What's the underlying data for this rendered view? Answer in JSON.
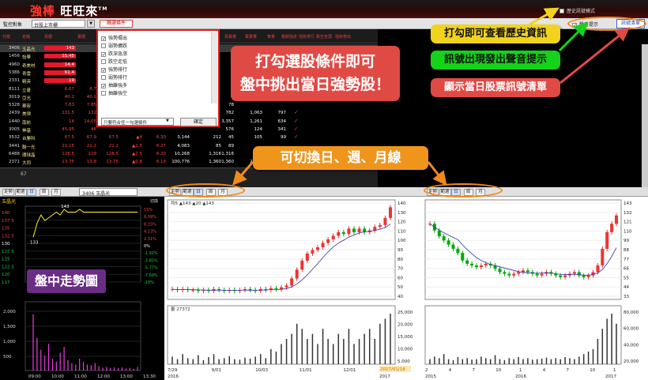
{
  "app": {
    "logo_main": "強棒",
    "logo_rest": "旺旺來",
    "logo_tm": "TM",
    "history_mode": "歷史訊號模式"
  },
  "toolbar": {
    "monitor_label": "監控對象",
    "monitor_value": "台股上市櫃",
    "screen_button": "篩選條件",
    "sound_label": "聲音提示",
    "signal_list_button": "訊號清單"
  },
  "grid": {
    "headers": [
      "代號",
      "名稱",
      "買價",
      "賣價",
      "",
      "",
      "",
      "",
      "",
      "",
      "",
      "",
      "",
      "",
      "",
      "",
      "",
      "買賣量",
      "賣賣量",
      "筆量",
      "趨勢強走",
      "強勢排行",
      "跌空走弱",
      "強勢帶出"
    ],
    "rows": [
      {
        "sym": "3406",
        "name": "玉晶光",
        "price": "143",
        "bid": "",
        "c3": "",
        "c4": "",
        "c5": "",
        "chk": false,
        "sel": true,
        "hl": true
      },
      {
        "sym": "1456",
        "name": "怡華",
        "price": "15.45",
        "bid": "",
        "c3": "",
        "c4": "",
        "c5": "",
        "chk": false,
        "hl": true
      },
      {
        "sym": "4960",
        "name": "奇美材",
        "price": "14.4",
        "bid": "",
        "c3": "",
        "c4": "",
        "c5": "",
        "chk": false,
        "hl": true
      },
      {
        "sym": "5386",
        "name": "青雲",
        "price": "61.4",
        "bid": "",
        "c3": "",
        "c4": "",
        "c5": "",
        "chk": false,
        "hl": true
      },
      {
        "sym": "2331",
        "name": "精英",
        "price": "19",
        "bid": "",
        "c3": "",
        "c4": "",
        "c5": "",
        "chk": false,
        "hl": true
      },
      {
        "sym": "8111",
        "name": "立碁",
        "price": "6.67",
        "bid": "6.7",
        "c3": "",
        "c4": "",
        "c5": "",
        "chk": false
      },
      {
        "sym": "3019",
        "name": "亞光",
        "price": "40.1",
        "bid": "40.1",
        "c3": "",
        "c4": "",
        "c5": "",
        "chk": false
      },
      {
        "sym": "5328",
        "name": "華容",
        "price": "7.83",
        "bid": "7.85",
        "c3": "78",
        "c4": "",
        "c5": "",
        "chk": false
      },
      {
        "sym": "2439",
        "name": "美律",
        "price": "131.5",
        "bid": "132",
        "c3": "782",
        "c4": "1,063",
        "c5": "797",
        "chk": true
      },
      {
        "sym": "1440",
        "name": "南紡",
        "price": "14",
        "bid": "14.05",
        "c3": "3,357",
        "c4": "1,261",
        "c5": "634",
        "chk": true
      },
      {
        "sym": "3005",
        "name": "神基",
        "price": "45.95",
        "bid": "46",
        "c3": "576",
        "c4": "124",
        "c5": "341",
        "chk": true
      },
      {
        "sym": "3532",
        "name": "台勝科",
        "price": "67.5",
        "bid": "67.9",
        "c3": "45",
        "c4": "105",
        "c5": "99",
        "chk": true
      },
      {
        "sym": "3441",
        "name": "聯一光",
        "price": "21.15",
        "bid": "21.2",
        "c3": "89",
        "c4": "",
        "c5": "",
        "chk": false
      },
      {
        "sym": "6488",
        "name": "環球晶",
        "price": "128.5",
        "bid": "129",
        "c3": "1,316",
        "c4": "147",
        "c5": "",
        "chk": false
      },
      {
        "sym": "2371",
        "name": "大同",
        "price": "13.75",
        "bid": "13.8",
        "c3": "1,360",
        "c4": "2,250",
        "c5": "",
        "chk": false
      }
    ],
    "extra": [
      {
        "v1": "21.2",
        "v2": "▲1.5",
        "v3": "6.27",
        "v4": "4,083",
        "v5": "85"
      },
      {
        "v1": "128.5",
        "v2": "▲7.5",
        "v3": "6.20",
        "v4": "10,268",
        "v5": "1,316"
      },
      {
        "v1": "13.75",
        "v2": "▲0.8",
        "v3": "6.18",
        "v4": "100,776",
        "v5": "1,360"
      },
      {
        "v1": "67.5",
        "v2": "▲4",
        "v3": "6.30",
        "v4": "3,144",
        "v5": "212"
      }
    ],
    "footer_count": "67"
  },
  "popup": {
    "items": [
      {
        "label": "強勢擺出",
        "checked": true
      },
      {
        "label": "弱勢擴跌",
        "checked": false
      },
      {
        "label": "跌深急漲",
        "checked": true
      },
      {
        "label": "跌空走低",
        "checked": false
      },
      {
        "label": "強勢排行",
        "checked": true
      },
      {
        "label": "弱勢排行",
        "checked": false
      },
      {
        "label": "抽離強多",
        "checked": true
      },
      {
        "label": "抽離強空",
        "checked": false
      }
    ],
    "mode": "只要符合任一勾選條件",
    "ok": "確定"
  },
  "callouts": {
    "a1": "打勾選股條件即可",
    "a2": "盤中挑出當日強勢股！",
    "b": "可切換日、週、月線",
    "c": "打勾即可查看歷史資訊",
    "d": "訊號出現發出聲音提示",
    "e": "顯示當日股票訊號清單",
    "f": "盤中走勢圖"
  },
  "tabs": [
    "走勢",
    "範選",
    "日",
    "周",
    "月"
  ],
  "intraday": {
    "stock": "3406 玉晶光",
    "title": "玉晶光",
    "switch": "切換",
    "high": "143",
    "low": "133",
    "price_ticks": [
      "140",
      "137.5",
      "135",
      "132.5",
      "130",
      "127.5",
      "125",
      "122.5",
      "120",
      "117"
    ],
    "pct_ticks": [
      "15%",
      "8.09%",
      "6.15%",
      "4.23%",
      "2.31%",
      "0%",
      "-1.92%",
      "-3.85%",
      "-5.77%",
      "-7.69%",
      "-10%"
    ],
    "vol_ticks": [
      "2,000",
      "1,500",
      "1,000",
      "500"
    ],
    "time_ticks": [
      "09:00",
      "10:00",
      "11:00",
      "12:00",
      "13:00",
      "13:30"
    ],
    "chart_data": {
      "type": "line",
      "x": [
        "09:00",
        "09:10",
        "09:20",
        "09:30",
        "09:40",
        "09:50",
        "10:00",
        "10:10",
        "10:20",
        "10:30",
        "10:40",
        "10:50",
        "11:00",
        "11:10",
        "11:20",
        "11:30",
        "11:40",
        "11:50",
        "12:00",
        "12:10",
        "12:20",
        "12:30",
        "12:40",
        "12:50",
        "13:00",
        "13:10",
        "13:20",
        "13:30"
      ],
      "series": [
        {
          "values": [
            133,
            138,
            141,
            139,
            140,
            141,
            142,
            141,
            143,
            142,
            142,
            142,
            143,
            142,
            142,
            142,
            142,
            142,
            142,
            142,
            142,
            142,
            142,
            142,
            142,
            142,
            142,
            142
          ]
        }
      ],
      "ylim": [
        117,
        143
      ]
    }
  },
  "daily": {
    "ma_label": "均5 ▲143 ▲20 ▲143",
    "vol_label": "量 27372",
    "price_ticks": [
      "140",
      "130",
      "120",
      "110",
      "100",
      "90",
      "80",
      "70",
      "60",
      "50",
      "40"
    ],
    "vol_ticks": [
      "25,000",
      "20,000",
      "15,000",
      "10,000",
      "5,000"
    ],
    "date_ticks": [
      "7/29",
      "9/01",
      "10/03",
      "11/01",
      "12/01",
      "1/03"
    ],
    "years": [
      "2016",
      "2017"
    ],
    "date_stamp": "2017/01/18",
    "chart_data": {
      "type": "line",
      "series": [
        {
          "name": "收盤",
          "values": [
            48,
            47,
            48,
            47,
            47,
            46,
            47,
            46,
            48,
            47,
            46,
            47,
            46,
            47,
            48,
            47,
            46,
            48,
            47,
            49,
            48,
            50,
            52,
            60,
            70,
            80,
            88,
            92,
            95,
            100,
            104,
            108,
            112,
            110,
            116,
            112,
            116,
            112,
            114,
            118,
            120,
            128,
            140
          ]
        }
      ],
      "ylim": [
        40,
        143
      ]
    }
  },
  "weekly": {
    "price_ticks": [
      "143",
      "132",
      "121",
      "110",
      "99",
      "88",
      "77",
      "66",
      "55",
      "44",
      "33"
    ],
    "vol_ticks": [
      "80,000",
      "60,000",
      "40,000",
      "20,000"
    ],
    "date_ticks": [
      "2",
      "4",
      "7",
      "10",
      "1",
      "4",
      "7",
      "10",
      "1"
    ],
    "years": [
      "2015",
      "2016",
      "2017"
    ],
    "chart_data": {
      "type": "line",
      "series": [
        {
          "name": "收盤",
          "values": [
            120,
            112,
            105,
            100,
            95,
            90,
            85,
            76,
            72,
            70,
            68,
            70,
            72,
            70,
            66,
            62,
            60,
            58,
            60,
            62,
            64,
            62,
            60,
            58,
            60,
            62,
            60,
            58,
            56,
            58,
            60,
            62,
            58,
            56,
            58,
            62,
            70,
            90,
            110,
            120,
            130
          ]
        }
      ],
      "ylim": [
        33,
        143
      ]
    }
  }
}
